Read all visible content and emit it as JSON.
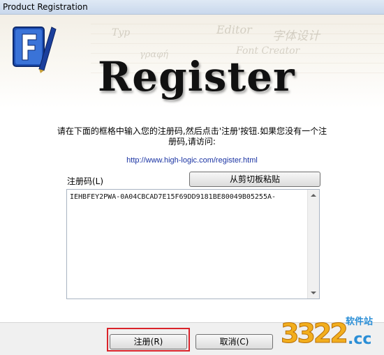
{
  "window": {
    "title": "Product Registration"
  },
  "banner": {
    "heading": "Register",
    "watermarks": [
      "Editor",
      "字体设计",
      "Font Creator",
      "γραφή",
      "Typ"
    ]
  },
  "instructions": "请在下面的框格中输入您的注册码,然后点击'注册'按钮.如果您没有一个注册码,请访问:",
  "url": "http://www.high-logic.com/register.html",
  "registration": {
    "label": "注册码(L)",
    "paste_button": "从剪切板粘贴",
    "code": "IEHBFEY2PWA-0A04CBCAD7E15F69DD9181BE80049B05255A-"
  },
  "buttons": {
    "register": "注册(R)",
    "cancel": "取消(C)"
  },
  "watermark": {
    "site_cn": "软件站",
    "site_num": "3322",
    "site_tld": ".cc"
  },
  "colors": {
    "highlight": "#d9232a",
    "link": "#1a33a3",
    "wm_orange": "#f2ae1d",
    "wm_blue": "#2a8ed6"
  }
}
